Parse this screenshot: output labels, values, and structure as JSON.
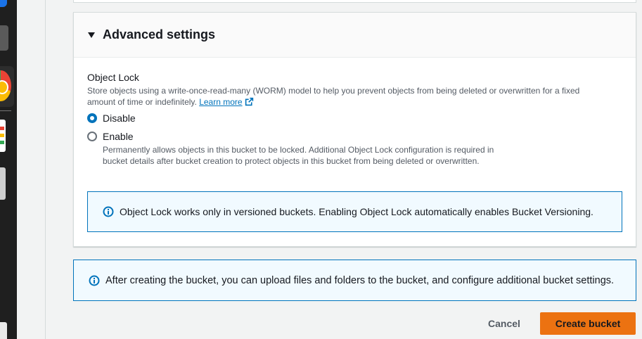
{
  "advanced_settings": {
    "title": "Advanced settings",
    "object_lock": {
      "label": "Object Lock",
      "description": "Store objects using a write-once-read-many (WORM) model to help you prevent objects from being deleted or overwritten for a fixed amount of time or indefinitely.",
      "learn_more": "Learn more",
      "options": [
        {
          "label": "Disable",
          "selected": true
        },
        {
          "label": "Enable",
          "selected": false,
          "description": "Permanently allows objects in this bucket to be locked. Additional Object Lock configuration is required in bucket details after bucket creation to protect objects in this bucket from being deleted or overwritten."
        }
      ],
      "info": "Object Lock works only in versioned buckets. Enabling Object Lock automatically enables Bucket Versioning."
    }
  },
  "footer": {
    "info": "After creating the bucket, you can upload files and folders to the bucket, and configure additional bucket settings.",
    "cancel_label": "Cancel",
    "create_label": "Create bucket"
  },
  "colors": {
    "primary_button": "#ec7211",
    "link": "#0073bb",
    "info_border": "#0073bb",
    "info_background": "#f1faff"
  },
  "icons": [
    "caret-down-icon",
    "external-link-icon",
    "info-icon"
  ]
}
